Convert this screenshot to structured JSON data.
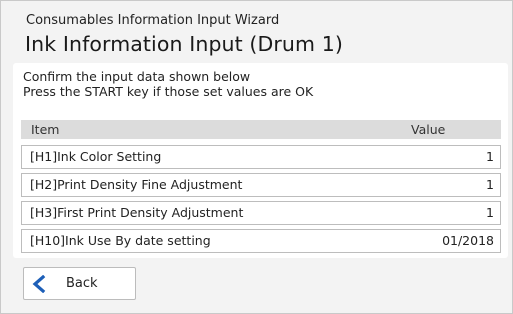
{
  "header": {
    "wizard_title": "Consumables Information Input Wizard",
    "page_title": "Ink Information Input (Drum 1)"
  },
  "instructions": {
    "line1": "Confirm the input data shown below",
    "line2": "Press the START key if those set values are OK"
  },
  "table": {
    "headers": {
      "item": "Item",
      "value": "Value"
    },
    "rows": [
      {
        "label": "[H1]Ink Color Setting",
        "value": "1"
      },
      {
        "label": "[H2]Print Density Fine Adjustment",
        "value": "1"
      },
      {
        "label": "[H3]First Print Density Adjustment",
        "value": "1"
      },
      {
        "label": "[H10]Ink Use By date setting",
        "value": "01/2018"
      }
    ]
  },
  "footer": {
    "back_label": "Back",
    "back_icon": "chevron-left-icon"
  },
  "colors": {
    "accent_blue": "#1d5fb8",
    "background": "#f3f3f3",
    "header_row": "#dcdcdc"
  }
}
